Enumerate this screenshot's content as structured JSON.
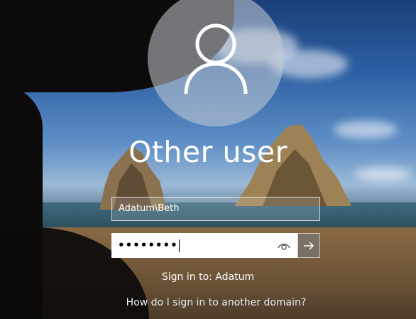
{
  "login": {
    "display_name": "Other user",
    "username_value": "Adatum\\Beth",
    "password_mask": "••••••••",
    "sign_in_to": "Sign in to: Adatum",
    "help_link": "How do I sign in to another domain?"
  },
  "icons": {
    "avatar": "user-avatar-icon",
    "reveal": "eye-icon",
    "submit": "arrow-right-icon"
  },
  "colors": {
    "password_bg": "#ffffff",
    "submit_bg": "#787878"
  }
}
